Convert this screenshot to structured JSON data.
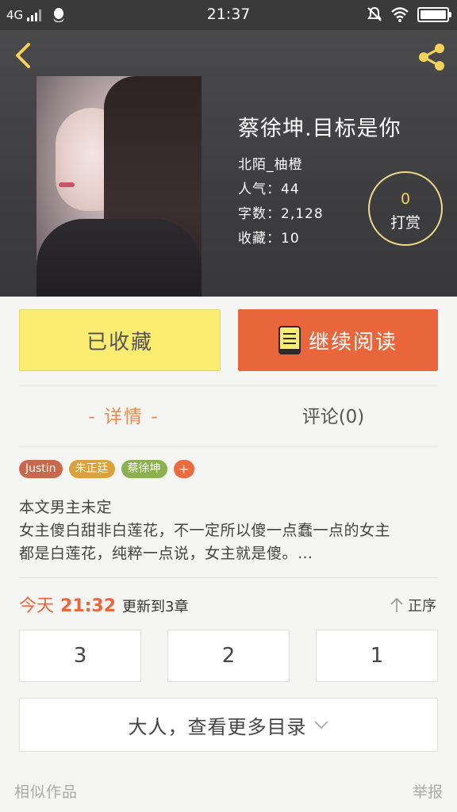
{
  "status_bar": {
    "network": "4G",
    "time": "21:37"
  },
  "book": {
    "title": "蔡徐坤.目标是你",
    "author": "北陌_柚橙",
    "popularity": "人气：44",
    "word_count": "字数：2,128",
    "favorites": "收藏：10"
  },
  "reward": {
    "count": "0",
    "label": "打赏"
  },
  "actions": {
    "favorited_label": "已收藏",
    "continue_label": "继续阅读"
  },
  "tabs": [
    {
      "label": "- 详情 -",
      "active": true
    },
    {
      "label": "评论(0)",
      "active": false
    }
  ],
  "tags": [
    {
      "label": "Justin",
      "color": "#c8694e"
    },
    {
      "label": "朱正廷",
      "color": "#d9a23c"
    },
    {
      "label": "蔡徐坤",
      "color": "#8bb050"
    },
    {
      "label": "+",
      "color": "#ea6c3e"
    }
  ],
  "description": {
    "line1": "本文男主未定",
    "line2": "女主傻白甜非白莲花，不一定所以傻一点蠢一点的女主",
    "line3": "都是白莲花，纯粹一点说，女主就是傻。…"
  },
  "update": {
    "day": "今天",
    "time": "21:32",
    "text": "更新到3章"
  },
  "sort_label": "正序",
  "chapters": [
    "3",
    "2",
    "1"
  ],
  "more_label": "大人，查看更多目录",
  "footer": {
    "similar": "相似作品",
    "report": "举报"
  },
  "colors": {
    "accent_orange": "#e9653b",
    "fav_yellow": "#fbec72",
    "reward_gold": "#f5d35a",
    "back_icon": "#f5d35a"
  }
}
